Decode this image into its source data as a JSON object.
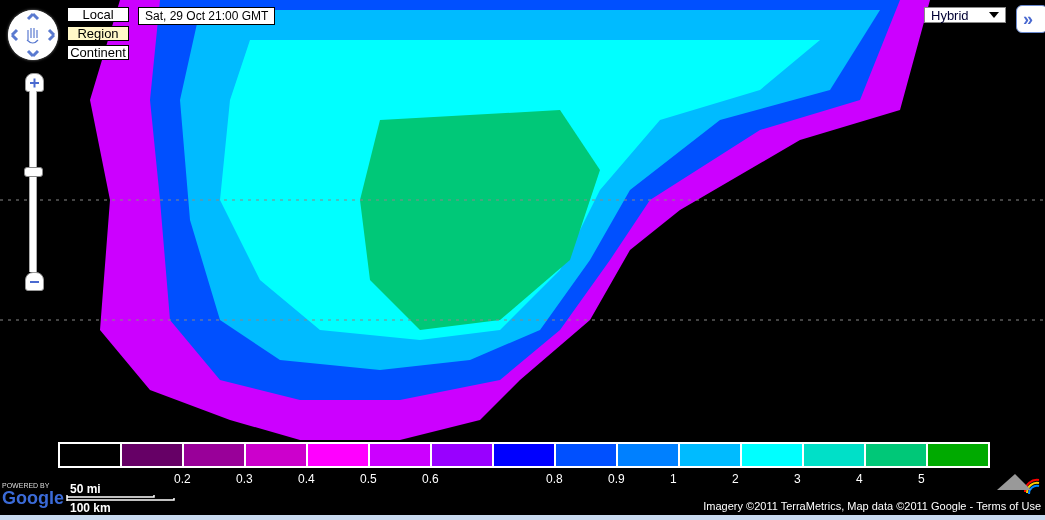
{
  "view_buttons": [
    {
      "label": "Local",
      "selected": false
    },
    {
      "label": "Region",
      "selected": true
    },
    {
      "label": "Continent",
      "selected": false
    }
  ],
  "time_label": "Sat, 29 Oct 21:00 GMT",
  "map_type": {
    "value": "Hybrid"
  },
  "expand_button": {
    "label": "»"
  },
  "zoom": {
    "level": 0.56
  },
  "legend": {
    "swatches": [
      {
        "color": "#000000"
      },
      {
        "color": "#660066"
      },
      {
        "color": "#990099"
      },
      {
        "color": "#cc00cc"
      },
      {
        "color": "#ff00ff"
      },
      {
        "color": "#cc00ff"
      },
      {
        "color": "#9900ff"
      },
      {
        "color": "#0000ff"
      },
      {
        "color": "#0050ff"
      },
      {
        "color": "#0080ff"
      },
      {
        "color": "#00bbff"
      },
      {
        "color": "#00ffff"
      },
      {
        "color": "#00e0c8"
      },
      {
        "color": "#00c878"
      },
      {
        "color": "#00aa00"
      }
    ],
    "ticks": [
      "0.2",
      "0.3",
      "0.4",
      "0.5",
      "0.6",
      "0.8",
      "0.9",
      "1",
      "2",
      "3",
      "4",
      "5"
    ]
  },
  "powered_by": "POWERED BY",
  "logo": "Google",
  "scale": {
    "miles": "50 mi",
    "km": "100 km"
  },
  "attribution": {
    "text": "Imagery ©2011 TerraMetrics, Map data ©2011 Google -",
    "link": "Terms of Use"
  }
}
